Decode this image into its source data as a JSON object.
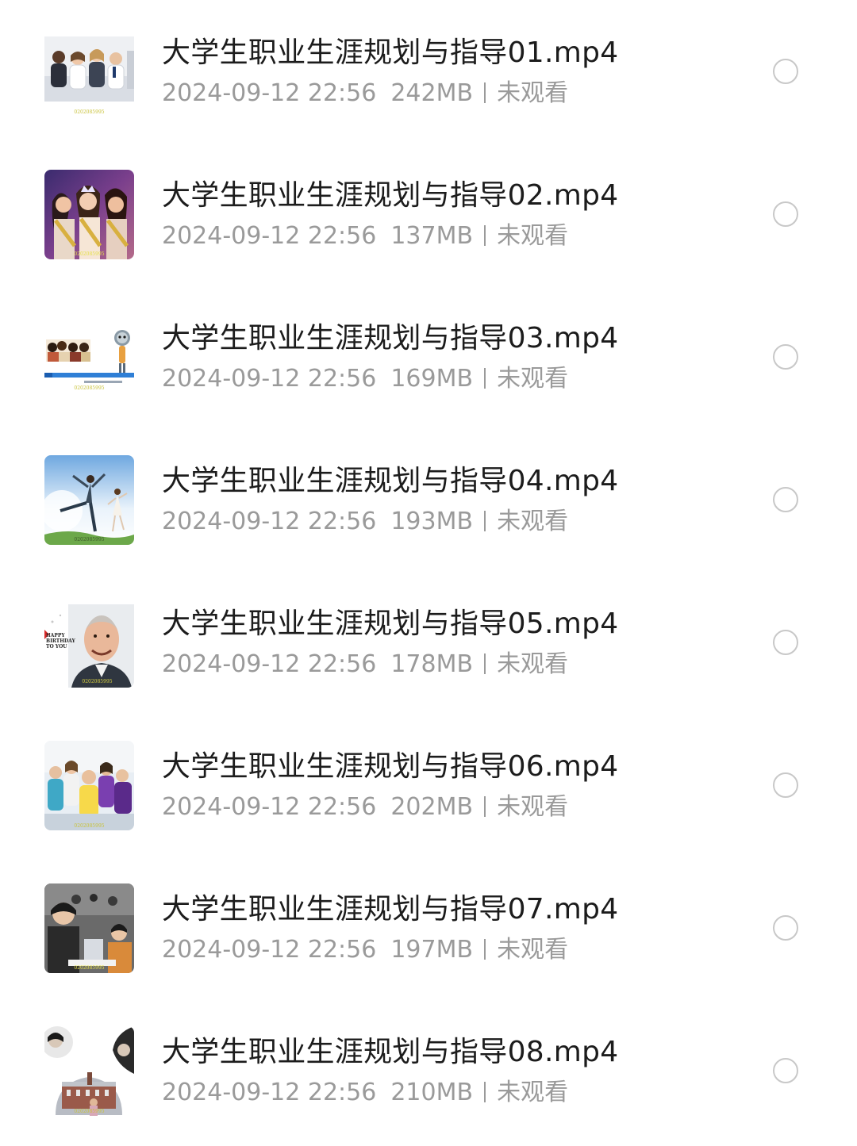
{
  "files": [
    {
      "name": "大学生职业生涯规划与指导01.mp4",
      "date": "2024-09-12 22:56",
      "size": "242MB",
      "status": "未观看",
      "thumb_text": "0202085995",
      "thumb_icon": "group-photo-thumbnail"
    },
    {
      "name": "大学生职业生涯规划与指导02.mp4",
      "date": "2024-09-12 22:56",
      "size": "137MB",
      "status": "未观看",
      "thumb_text": "0202085995",
      "thumb_icon": "pageant-photo-thumbnail"
    },
    {
      "name": "大学生职业生涯规划与指导03.mp4",
      "date": "2024-09-12 22:56",
      "size": "169MB",
      "status": "未观看",
      "thumb_text": "0202085995",
      "thumb_icon": "presentation-slide-thumbnail"
    },
    {
      "name": "大学生职业生涯规划与指导04.mp4",
      "date": "2024-09-12 22:56",
      "size": "193MB",
      "status": "未观看",
      "thumb_text": "0202085995",
      "thumb_icon": "leaping-people-thumbnail"
    },
    {
      "name": "大学生职业生涯规划与指导05.mp4",
      "date": "2024-09-12 22:56",
      "size": "178MB",
      "status": "未观看",
      "thumb_text": "0202085995",
      "thumb_icon": "smiling-man-thumbnail",
      "thumb_caption": "HAPPY BIRTHDAY TO YOU"
    },
    {
      "name": "大学生职业生涯规划与指导06.mp4",
      "date": "2024-09-12 22:56",
      "size": "202MB",
      "status": "未观看",
      "thumb_text": "0202085995",
      "thumb_icon": "friends-group-thumbnail"
    },
    {
      "name": "大学生职业生涯规划与指导07.mp4",
      "date": "2024-09-12 22:56",
      "size": "197MB",
      "status": "未观看",
      "thumb_text": "0202085995",
      "thumb_icon": "classroom-thumbnail"
    },
    {
      "name": "大学生职业生涯规划与指导08.mp4",
      "date": "2024-09-12 22:56",
      "size": "210MB",
      "status": "未观看",
      "thumb_text": "0202085995",
      "thumb_icon": "campus-collage-thumbnail"
    }
  ],
  "colors": {
    "title": "#1c1c1c",
    "meta": "#9a9a9a",
    "radio_border": "#c8c8c8",
    "background": "#ffffff"
  },
  "icons": {
    "select": "radio-unselected-icon"
  }
}
